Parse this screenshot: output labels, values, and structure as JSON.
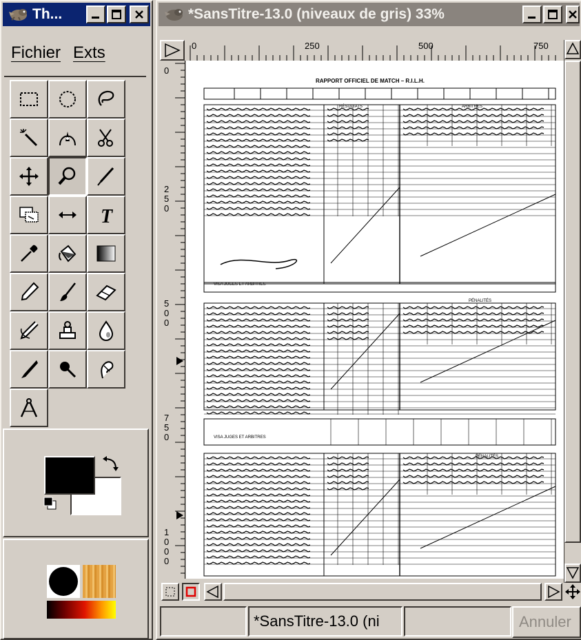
{
  "toolbox": {
    "title": "Th...",
    "menu": [
      "Fichier",
      "Exts"
    ],
    "tools": [
      "rect-select-icon",
      "ellipse-select-icon",
      "lasso-icon",
      "magic-wand-icon",
      "bezier-select-icon",
      "scissors-icon",
      "move-icon",
      "magnify-icon",
      "crop-icon",
      "transform-icon",
      "flip-icon",
      "text-icon",
      "color-picker-icon",
      "bucket-fill-icon",
      "gradient-icon",
      "pencil-icon",
      "paintbrush-icon",
      "eraser-icon",
      "airbrush-icon",
      "clone-icon",
      "convolve-icon",
      "ink-icon",
      "dodge-burn-icon",
      "smudge-icon",
      "measure-icon"
    ],
    "active_tool_index": 7,
    "fg_color": "#000000",
    "bg_color": "#ffffff"
  },
  "image_window": {
    "title": "*SansTitre-13.0 (niveaux de gris) 33%",
    "ruler_top_labels": [
      "0",
      "250",
      "500",
      "750"
    ],
    "ruler_left_labels": [
      "0",
      "250",
      "500",
      "750",
      "1000"
    ],
    "status_filename": "*SansTitre-13.0 (ni",
    "cancel_label": "Annuler"
  },
  "document": {
    "title": "RAPPORT OFFICIEL DE MATCH – R.I.L.H.",
    "section_labels": [
      "ARBITRES",
      "RÉSULTATS",
      "PÉNALITÉS",
      "VISA JUGES ET ARBITRES"
    ]
  },
  "colors": {
    "title_active": "#0b2470",
    "title_inactive": "#8a847e",
    "face": "#d4cec6"
  }
}
